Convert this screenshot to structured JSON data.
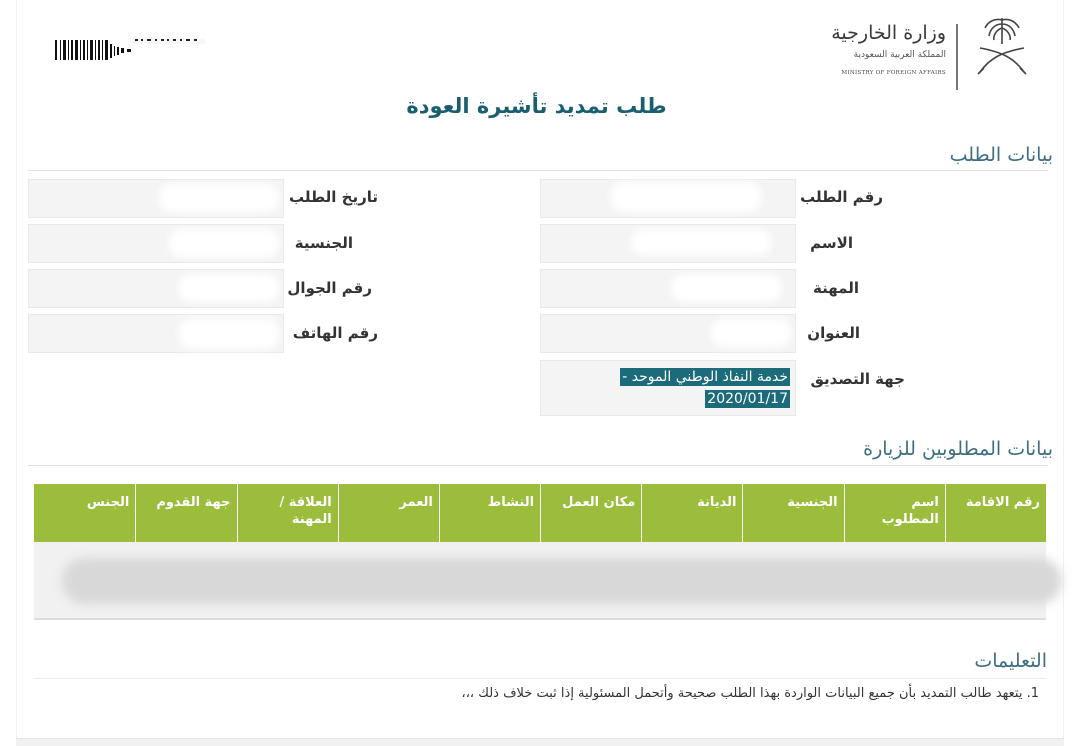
{
  "header": {
    "ministry_ar": "وزارة الخارجية",
    "ministry_ar_sub": "المملكة العربية السعودية",
    "ministry_en": "MINISTRY OF FOREIGN AFFAIRS"
  },
  "page_title": "طلب تمديد تأشيرة العودة",
  "request_section": {
    "title": "بيانات الطلب",
    "fields": {
      "request_number": {
        "label": "رقم الطلب",
        "value": ""
      },
      "request_date": {
        "label": "تاريخ الطلب",
        "value": ""
      },
      "name": {
        "label": "الاسم",
        "value": ""
      },
      "nationality": {
        "label": "الجنسية",
        "value": ""
      },
      "profession": {
        "label": "المهنة",
        "value": ""
      },
      "mobile": {
        "label": "رقم الجوال",
        "value": ""
      },
      "address": {
        "label": "العنوان",
        "value": ""
      },
      "phone": {
        "label": "رقم الهاتف",
        "value": ""
      },
      "authentication": {
        "label": "جهة التصديق",
        "value_line1": "خدمة النفاذ الوطني الموحد -",
        "value_line2": "2020/01/17"
      }
    }
  },
  "visitors_section": {
    "title": "بيانات المطلوبين للزيارة",
    "columns": [
      "رقم الاقامة",
      "اسم المطلوب",
      "الجنسية",
      "الديانة",
      "مكان العمل",
      "النشاط",
      "العمر",
      "العلاقة / المهنة",
      "جهة القدوم",
      "الجنس"
    ],
    "rows": []
  },
  "instructions": {
    "title": "التعليمات",
    "items": [
      "1. يتعهد طالب التمديد بأن جميع البيانات الواردة بهذا الطلب صحيحة وأتحمل المسئولية إذا ثبت خلاف ذلك ،،،"
    ]
  },
  "colors": {
    "title": "#1b5e6f",
    "section_title": "#3e6f80",
    "table_header": "#9cbc3c",
    "highlight": "#1b6b7a"
  }
}
